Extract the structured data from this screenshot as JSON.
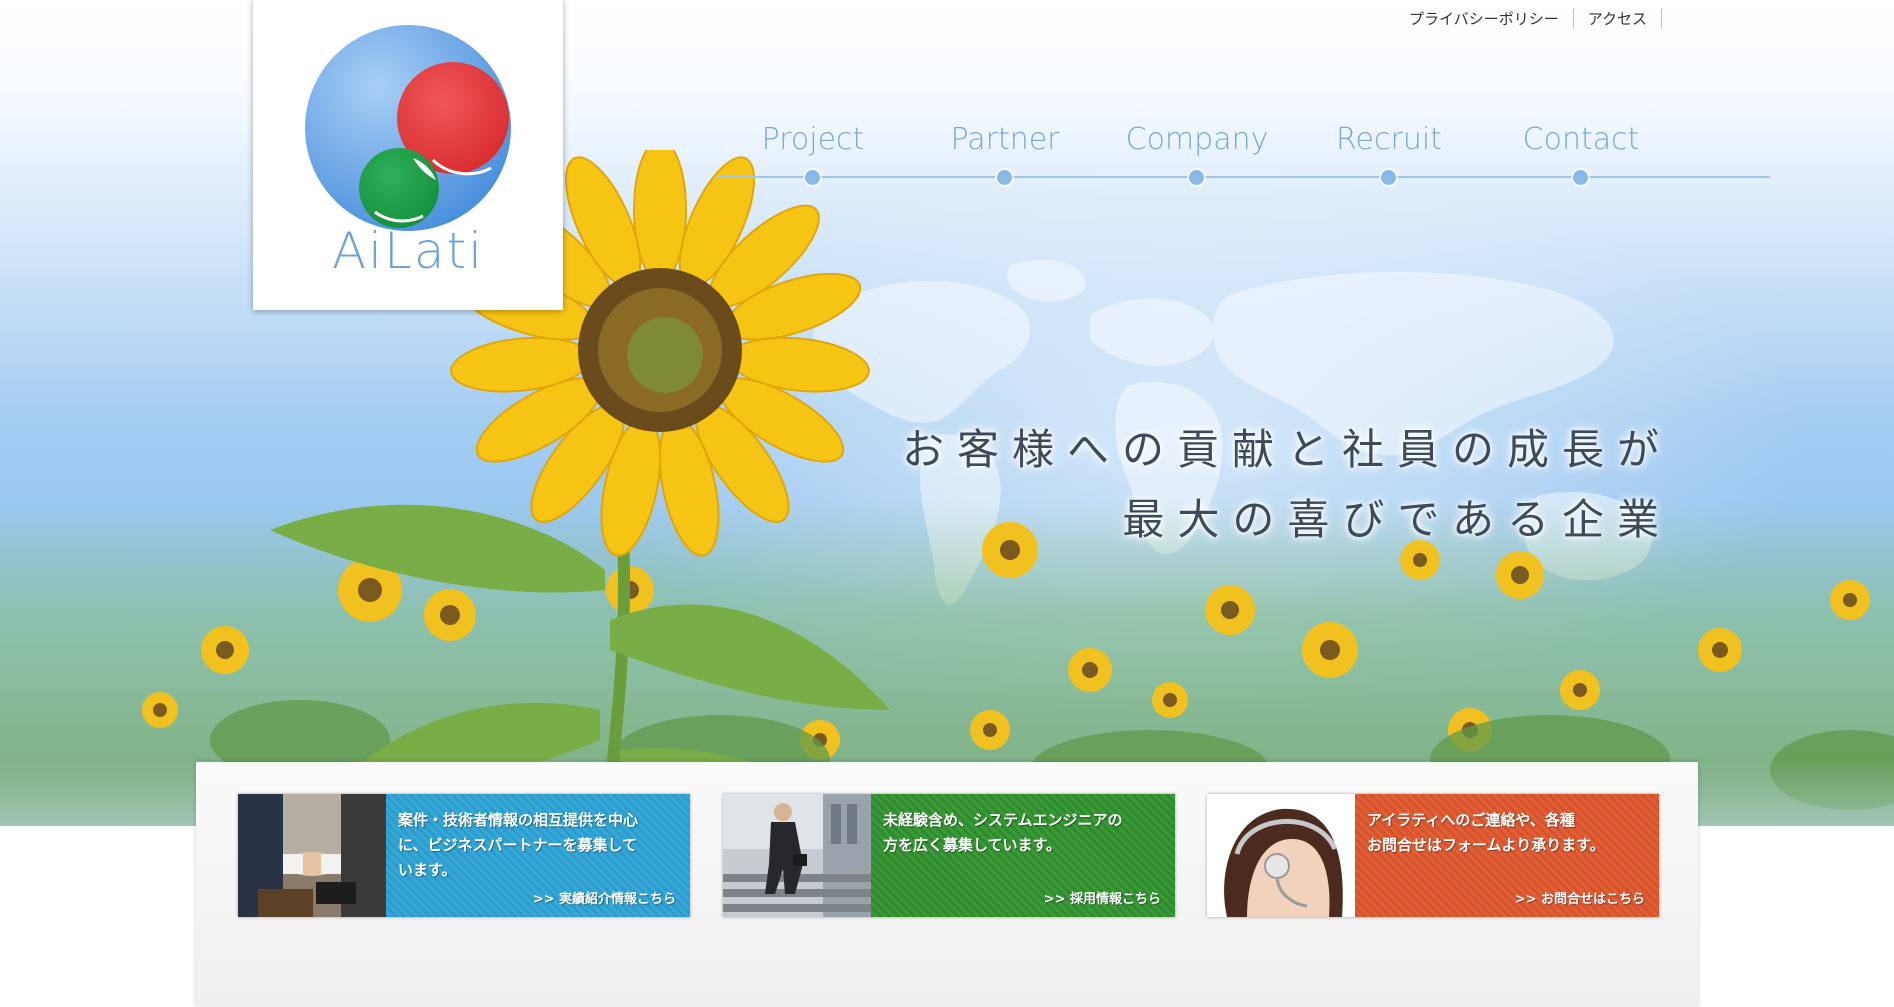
{
  "site": {
    "logo_text": "AiLati",
    "logo_icon": "ailati-circles-logo-icon"
  },
  "top_links": [
    {
      "label": "プライバシーポリシー"
    },
    {
      "label": "アクセス"
    }
  ],
  "nav": [
    {
      "label": "Project"
    },
    {
      "label": "Partner"
    },
    {
      "label": "Company"
    },
    {
      "label": "Recruit"
    },
    {
      "label": "Contact"
    }
  ],
  "hero": {
    "catch_line1": "お客様への貢献と社員の成長が",
    "catch_line2": "最大の喜びである企業",
    "image": "sunflower-field-world-map"
  },
  "banners": [
    {
      "line1": "案件・技術者情報の相互提供を中心",
      "line2": "に、ビジネスパートナーを募集して",
      "line3": "います。",
      "more": ">> 実績紹介情報こちら",
      "photo": "handshake-photo",
      "color": "#2f9fcf"
    },
    {
      "line1": "未経験含め、システムエンジニアの",
      "line2": "方を広く募集しています。",
      "line3": "",
      "more": ">> 採用情報こちら",
      "photo": "businessman-stairs-photo",
      "color": "#339233"
    },
    {
      "line1": "アイラティへのご連絡や、各種",
      "line2": "お問合せはフォームより承ります。",
      "line3": "",
      "more": ">> お問合せはこちら",
      "photo": "headset-operator-photo",
      "color": "#da5830"
    }
  ],
  "colors": {
    "nav_text": "#7aa7d5",
    "nav_line": "#9fc5ea",
    "logo_blue": "#5b9be0",
    "logo_red": "#e03a3c",
    "logo_green": "#1f9d46"
  }
}
